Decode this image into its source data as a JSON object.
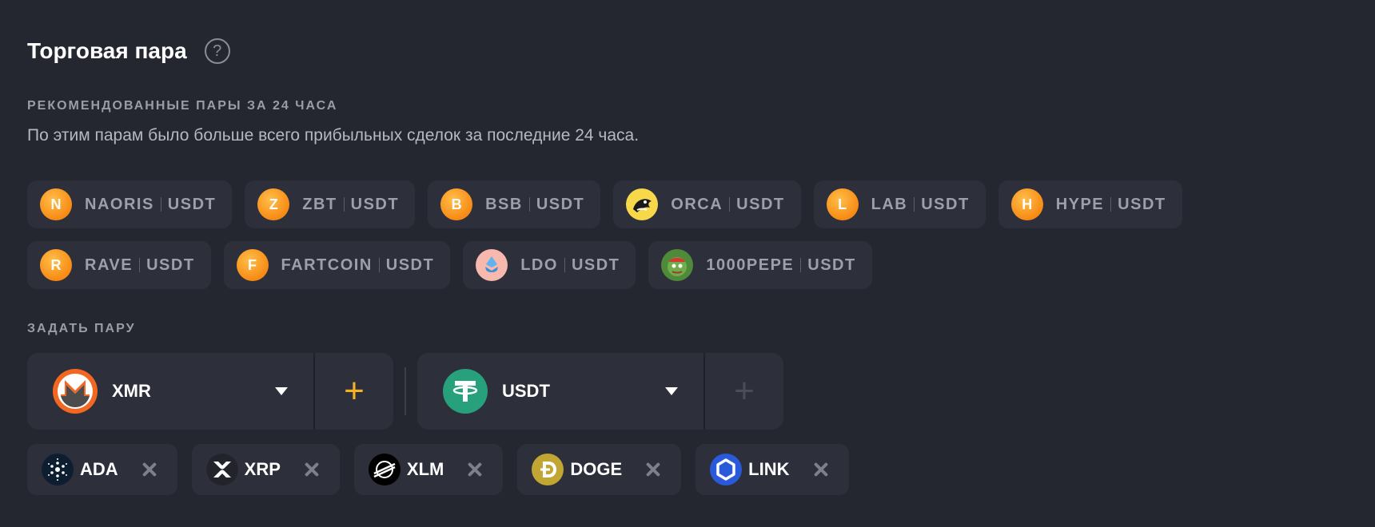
{
  "header": {
    "title": "Торговая пара",
    "help_glyph": "?"
  },
  "recommended": {
    "label": "РЕКОМЕНДОВАННЫЕ ПАРЫ ЗА 24 ЧАСА",
    "description": "По этим парам было больше всего прибыльных сделок за последние 24 часа.",
    "row1": [
      {
        "letter": "N",
        "base": "NAORIS",
        "quote": "USDT",
        "icon": "naoris-coin-icon"
      },
      {
        "letter": "Z",
        "base": "ZBT",
        "quote": "USDT",
        "icon": "zbt-coin-icon"
      },
      {
        "letter": "B",
        "base": "BSB",
        "quote": "USDT",
        "icon": "bsb-coin-icon"
      },
      {
        "letter": "",
        "base": "ORCA",
        "quote": "USDT",
        "icon": "orca-coin-icon"
      },
      {
        "letter": "L",
        "base": "LAB",
        "quote": "USDT",
        "icon": "lab-coin-icon"
      },
      {
        "letter": "H",
        "base": "HYPE",
        "quote": "USDT",
        "icon": "hype-coin-icon"
      }
    ],
    "row2": [
      {
        "letter": "R",
        "base": "RAVE",
        "quote": "USDT",
        "icon": "rave-coin-icon"
      },
      {
        "letter": "F",
        "base": "FARTCOIN",
        "quote": "USDT",
        "icon": "fartcoin-coin-icon"
      },
      {
        "letter": "",
        "base": "LDO",
        "quote": "USDT",
        "icon": "ldo-coin-icon"
      },
      {
        "letter": "",
        "base": "1000PEPE",
        "quote": "USDT",
        "icon": "pepe-coin-icon"
      }
    ]
  },
  "set_pair": {
    "label": "ЗАДАТЬ ПАРУ",
    "base": {
      "label": "XMR",
      "icon": "monero-icon",
      "color": "#f26822"
    },
    "quote": {
      "label": "USDT",
      "icon": "tether-icon",
      "color": "#26a17b"
    },
    "add_glyph": "+",
    "add_active_color": "#f5b323",
    "add_inactive_color": "#4a4c58"
  },
  "selected_tags": [
    {
      "label": "ADA",
      "icon": "cardano-icon"
    },
    {
      "label": "XRP",
      "icon": "xrp-icon"
    },
    {
      "label": "XLM",
      "icon": "stellar-icon"
    },
    {
      "label": "DOGE",
      "icon": "dogecoin-icon"
    },
    {
      "label": "LINK",
      "icon": "chainlink-icon"
    }
  ],
  "colors": {
    "background": "#242630",
    "chip": "#2d2f3a",
    "accent_orange": "#f78a14"
  }
}
